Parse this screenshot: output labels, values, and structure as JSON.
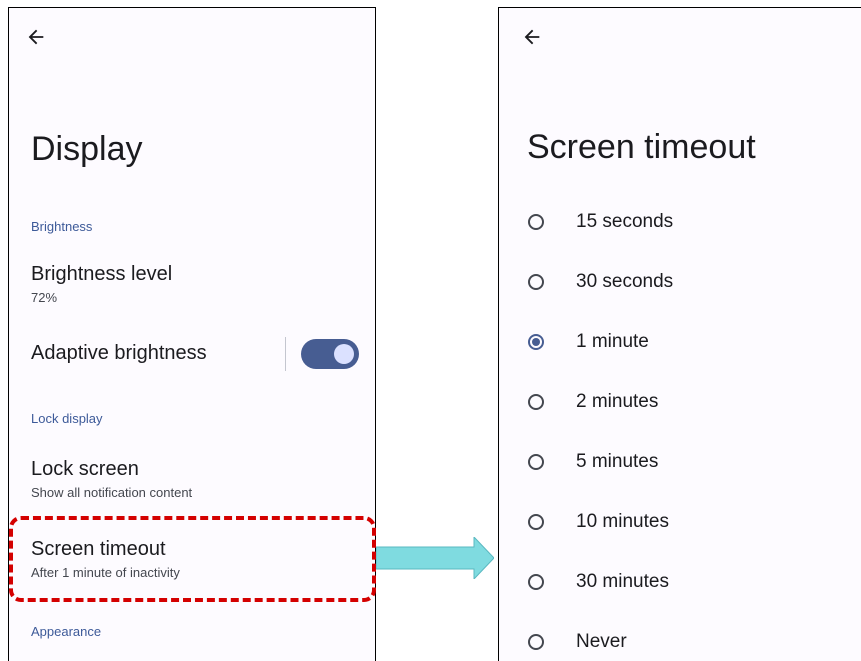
{
  "display_screen": {
    "title": "Display",
    "brightness_section": "Brightness",
    "brightness_level": {
      "title": "Brightness level",
      "summary": "72%"
    },
    "adaptive_brightness": {
      "title": "Adaptive brightness",
      "enabled": true
    },
    "lock_section": "Lock display",
    "lock_screen": {
      "title": "Lock screen",
      "summary": "Show all notification content"
    },
    "screen_timeout": {
      "title": "Screen timeout",
      "summary": "After 1 minute of inactivity"
    },
    "appearance_section": "Appearance"
  },
  "timeout_screen": {
    "title": "Screen timeout",
    "options": [
      {
        "label": "15 seconds",
        "selected": false
      },
      {
        "label": "30 seconds",
        "selected": false
      },
      {
        "label": "1 minute",
        "selected": true
      },
      {
        "label": "2 minutes",
        "selected": false
      },
      {
        "label": "5 minutes",
        "selected": false
      },
      {
        "label": "10 minutes",
        "selected": false
      },
      {
        "label": "30 minutes",
        "selected": false
      },
      {
        "label": "Never",
        "selected": false
      }
    ]
  },
  "colors": {
    "accent": "#475d92",
    "highlight": "#d40000",
    "arrow": "#7fdbe0"
  },
  "icons": {
    "back": "arrow-left-icon",
    "arrow": "right-arrow-icon"
  }
}
